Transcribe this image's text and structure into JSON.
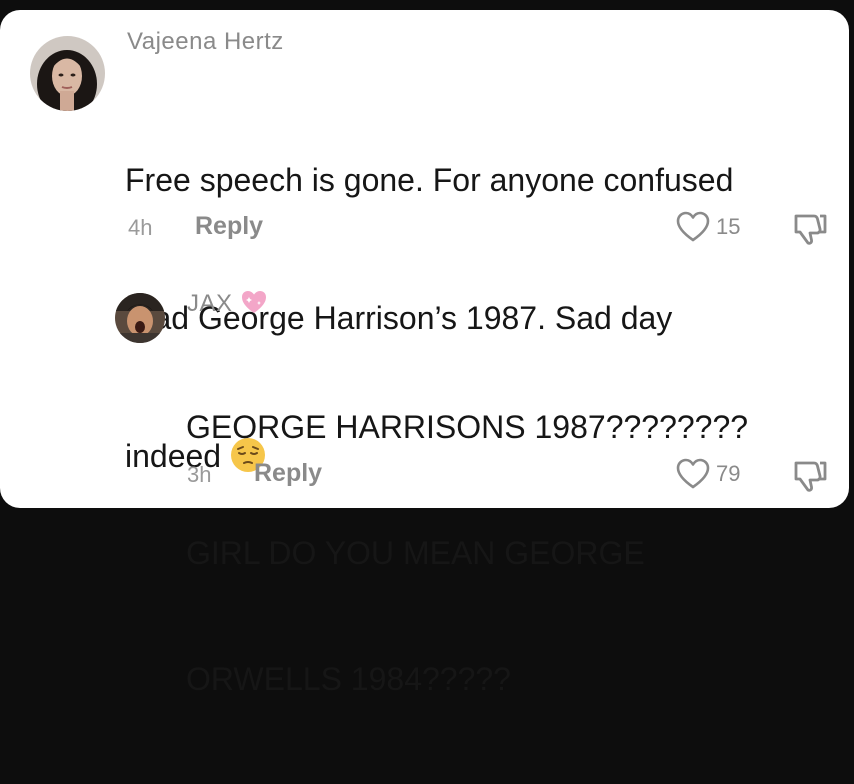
{
  "comments": [
    {
      "username": "Vajeena Hertz",
      "text_line1": "Free speech is gone. For anyone confused",
      "text_line2": "read George Harrison’s 1987. Sad day",
      "text_line3": "indeed ",
      "emoji": "pensive-face",
      "time": "4h",
      "reply_label": "Reply",
      "likes": "15"
    },
    {
      "username": "JAX ",
      "username_emoji": "sparkling-heart",
      "text_line1": "GEORGE HARRISONS 1987????????",
      "text_line2": "GIRL DO YOU MEAN GEORGE",
      "text_line3": "ORWELLS 1984?????",
      "time": "3h",
      "reply_label": "Reply",
      "likes": "79"
    }
  ],
  "colors": {
    "background": "#0d0d0d",
    "card": "#ffffff",
    "text": "#161616",
    "muted": "#8a8a8a",
    "heart_emoji": "#f3a6c8"
  }
}
